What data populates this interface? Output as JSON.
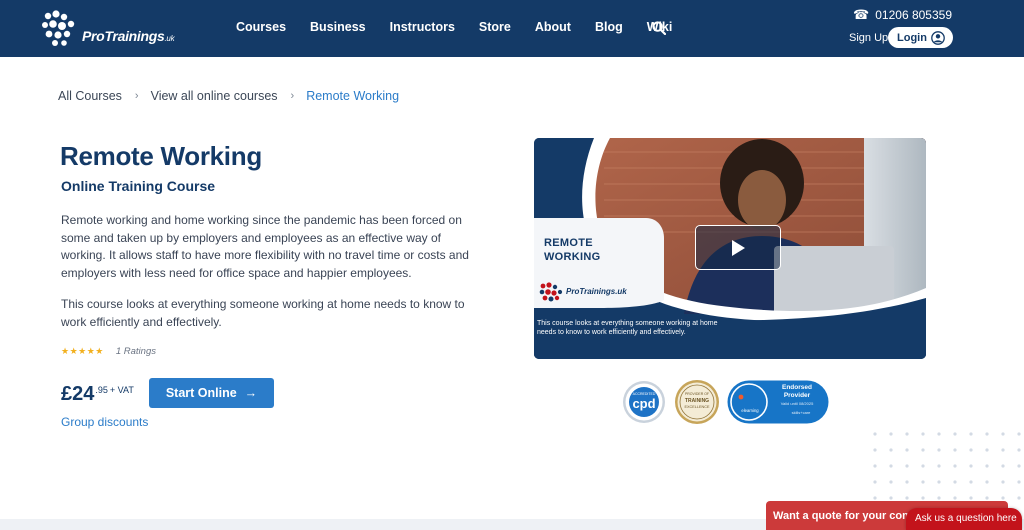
{
  "brand": {
    "logo_text": "ProTrainings",
    "logo_suffix": ".uk"
  },
  "nav": {
    "items": [
      "Courses",
      "Business",
      "Instructors",
      "Store",
      "About",
      "Blog",
      "Wiki"
    ],
    "search_icon": "search-icon"
  },
  "header": {
    "phone": "01206 805359",
    "phone_icon": "phone-icon",
    "signup_label": "Sign Up",
    "login_label": "Login",
    "login_icon": "user-circle-icon"
  },
  "breadcrumb": {
    "items": [
      "All Courses",
      "View all online courses",
      "Remote Working"
    ],
    "separator": "›"
  },
  "course": {
    "title": "Remote Working",
    "subtitle": "Online Training Course",
    "description_1": "Remote working and home working since the pandemic has been forced on some and taken up by employers and employees as an effective way of working.  It allows staff to have more flexibility with no travel time or costs and employers with less need for office space and happier employees.",
    "description_2": "This course looks at everything someone working at home needs to know to work efficiently and effectively.",
    "stars": "★★★★★",
    "rating_value": 5,
    "ratings_count": "1 Ratings",
    "price_main": "£24",
    "price_cents": ".95",
    "price_vat": "+ VAT",
    "start_label": "Start Online",
    "start_arrow": "→",
    "group_discounts": "Group discounts"
  },
  "video": {
    "title_line_1": "REMOTE",
    "title_line_2": "WORKING",
    "logo_text": "ProTrainings.uk",
    "caption": "This course looks at everything someone working at home needs to know to work efficiently and effectively.",
    "play_icon": "play-icon"
  },
  "badges": {
    "cpd_top": "ACCREDITED",
    "cpd_main": "cpd",
    "cpd_bottom": "COURSE",
    "trainer_top": "PROVIDER OF",
    "trainer_mid": "TRAINING",
    "trainer_bottom": "EXCELLENCE",
    "elearn_title_1": "Endorsed",
    "elearn_title_2": "Provider",
    "elearn_valid": "Valid until 08/2025",
    "elearn_brand": "elearning",
    "elearn_sub": "skills+care"
  },
  "chat": {
    "quote_label": "Want a quote for your com",
    "ask_label": "Ask us a question here"
  },
  "colors": {
    "header_bg": "#143a67",
    "accent_blue": "#2b7cc9",
    "title_navy": "#143a67",
    "star_gold": "#f2b01e",
    "quote_red": "#cc3a3a",
    "ask_red": "#c3131b"
  }
}
